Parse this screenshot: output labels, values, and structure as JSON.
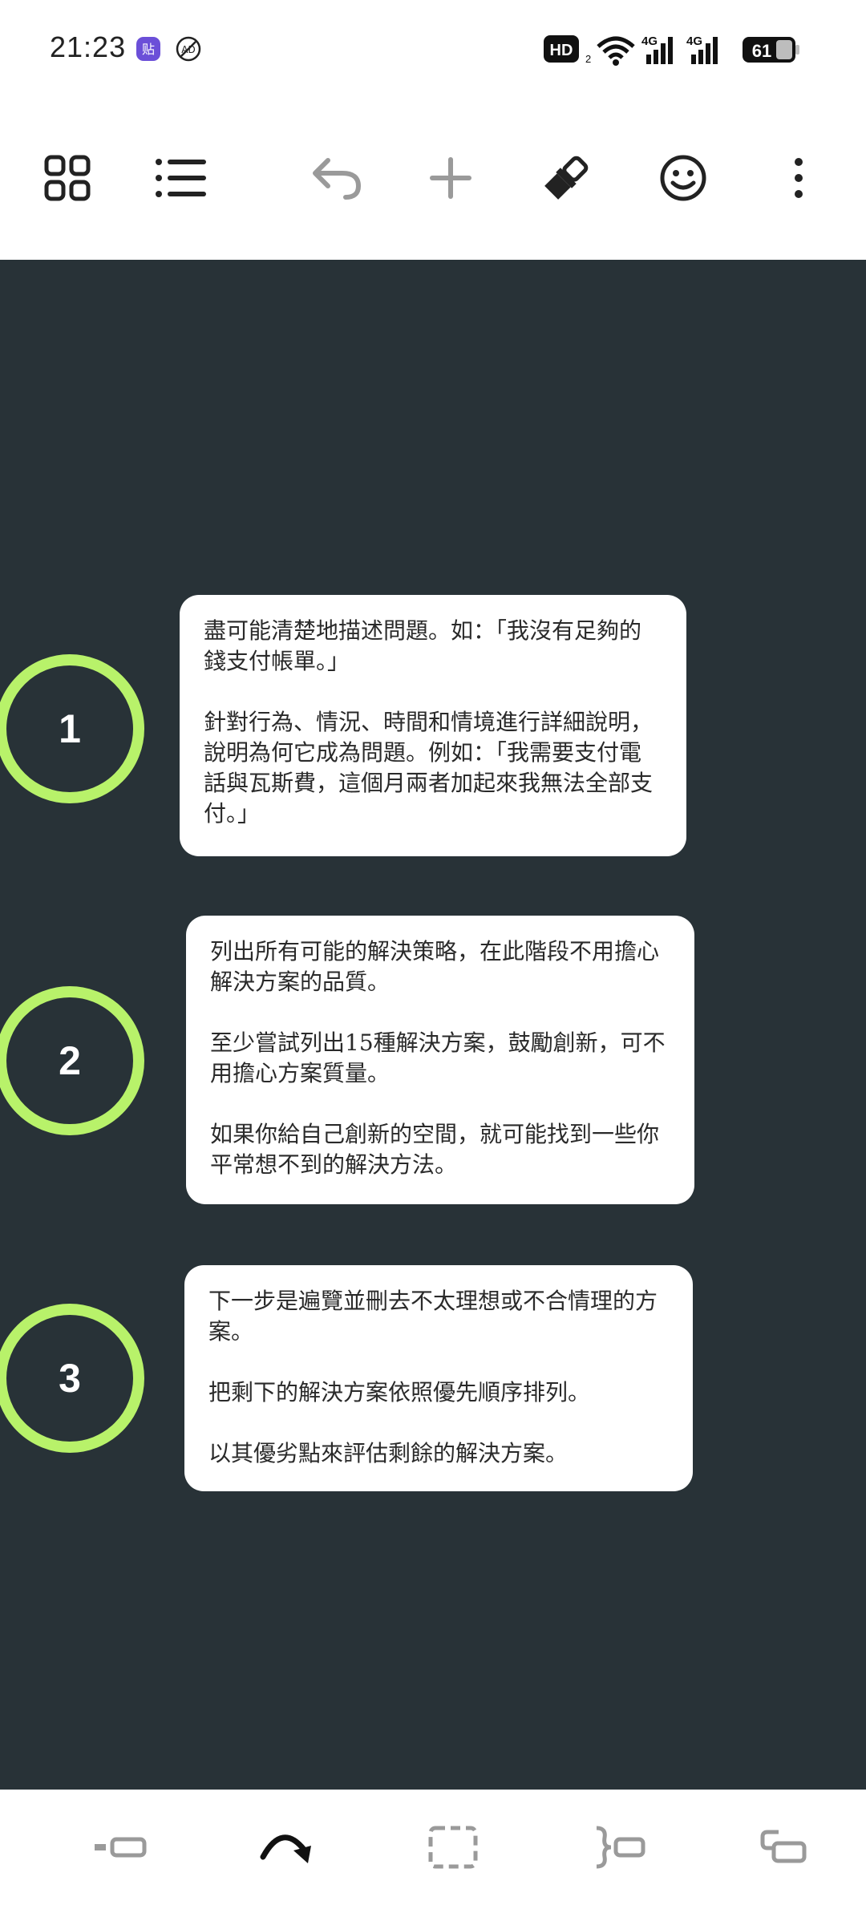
{
  "status_bar": {
    "time": "21:23",
    "battery": "61",
    "network_labels": [
      "HD",
      "4G",
      "4G"
    ],
    "app_icons": [
      "sticker-app-icon",
      "no-disturb-icon"
    ]
  },
  "toolbar": {
    "icons": [
      "grid-icon",
      "list-icon",
      "undo-icon",
      "add-icon",
      "brush-icon",
      "emoji-icon",
      "more-vert-icon"
    ]
  },
  "steps": [
    {
      "number": "1",
      "paragraphs": [
        "盡可能清楚地描述問題。如：「我沒有足夠的錢支付帳單。」",
        "針對行為、情況、時間和情境進行詳細說明，說明為何它成為問題。例如：「我需要支付電話與瓦斯費，這個月兩者加起來我無法全部支付。」"
      ]
    },
    {
      "number": "2",
      "paragraphs": [
        "列出所有可能的解決策略，在此階段不用擔心解決方案的品質。",
        "至少嘗試列出15種解決方案，鼓勵創新，可不用擔心方案質量。",
        "如果你給自己創新的空間，就可能找到一些你平常想不到的解決方法。"
      ]
    },
    {
      "number": "3",
      "paragraphs": [
        "下一步是遍覽並刪去不太理想或不合情理的方案。",
        "把剩下的解決方案依照優先順序排列。",
        "以其優劣點來評估剩餘的解決方案。"
      ]
    }
  ],
  "bottom_bar": {
    "icons": [
      "insert-sibling-icon",
      "relationship-arrow-icon",
      "boundary-icon",
      "summary-icon",
      "insert-child-icon"
    ]
  },
  "colors": {
    "canvas": "#283237",
    "circle_ring": "#b8f26a",
    "card": "#ffffff"
  }
}
